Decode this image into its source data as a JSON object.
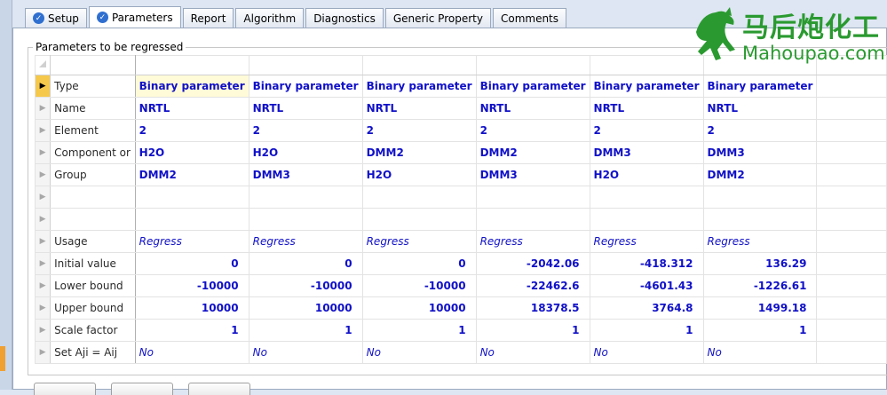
{
  "tabs": [
    {
      "label": "Setup",
      "checked": true
    },
    {
      "label": "Parameters",
      "checked": true,
      "active": true
    },
    {
      "label": "Report"
    },
    {
      "label": "Algorithm"
    },
    {
      "label": "Diagnostics"
    },
    {
      "label": "Generic Property"
    },
    {
      "label": "Comments"
    }
  ],
  "group_title": "Parameters to be regressed",
  "rows": [
    {
      "label": "Type",
      "values": [
        "Binary parameter",
        "Binary parameter",
        "Binary parameter",
        "Binary parameter",
        "Binary parameter",
        "Binary parameter"
      ]
    },
    {
      "label": "Name",
      "values": [
        "NRTL",
        "NRTL",
        "NRTL",
        "NRTL",
        "NRTL",
        "NRTL"
      ]
    },
    {
      "label": "Element",
      "values": [
        "2",
        "2",
        "2",
        "2",
        "2",
        "2"
      ]
    },
    {
      "label": "Component or",
      "values": [
        "H2O",
        "H2O",
        "DMM2",
        "DMM2",
        "DMM3",
        "DMM3"
      ]
    },
    {
      "label": "Group",
      "values": [
        "DMM2",
        "DMM3",
        "H2O",
        "DMM3",
        "H2O",
        "DMM2"
      ]
    },
    {
      "label": "",
      "values": [
        "",
        "",
        "",
        "",
        "",
        ""
      ]
    },
    {
      "label": "",
      "values": [
        "",
        "",
        "",
        "",
        "",
        ""
      ]
    },
    {
      "label": "Usage",
      "values": [
        "Regress",
        "Regress",
        "Regress",
        "Regress",
        "Regress",
        "Regress"
      ]
    },
    {
      "label": "Initial value",
      "values": [
        "0",
        "0",
        "0",
        "-2042.06",
        "-418.312",
        "136.29"
      ]
    },
    {
      "label": "Lower bound",
      "values": [
        "-10000",
        "-10000",
        "-10000",
        "-22462.6",
        "-4601.43",
        "-1226.61"
      ]
    },
    {
      "label": "Upper bound",
      "values": [
        "10000",
        "10000",
        "10000",
        "18378.5",
        "3764.8",
        "1499.18"
      ]
    },
    {
      "label": "Scale factor",
      "values": [
        "1",
        "1",
        "1",
        "1",
        "1",
        "1"
      ]
    },
    {
      "label": "Set Aji = Aij",
      "values": [
        "No",
        "No",
        "No",
        "No",
        "No",
        "No"
      ]
    }
  ],
  "watermark": {
    "cn": "马后炮化工",
    "en": "Mahoupao.com",
    "color": "#2a9a30"
  },
  "colors": {
    "value_text": "#1010c8",
    "current_row_marker": "#f5c84c",
    "tab_check": "#2f6fd0"
  }
}
